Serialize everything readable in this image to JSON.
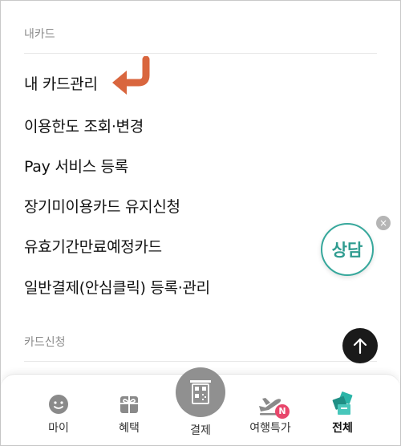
{
  "sections": {
    "my_card": "내카드",
    "card_apply": "카드신청"
  },
  "menu": [
    "내 카드관리",
    "이용한도 조회·변경",
    "Pay 서비스 등록",
    "장기미이용카드 유지신청",
    "유효기간만료예정카드",
    "일반결제(안심클릭) 등록·관리"
  ],
  "consult": {
    "label": "상담",
    "close": "×"
  },
  "bottom_nav": {
    "my": "마이",
    "benefit": "혜택",
    "pay": "결제",
    "travel": "여행특가",
    "travel_badge": "N",
    "all": "전체"
  },
  "colors": {
    "arrow": "#d9663e",
    "consult": "#37a89c",
    "all_icon": "#2bb5a8"
  }
}
